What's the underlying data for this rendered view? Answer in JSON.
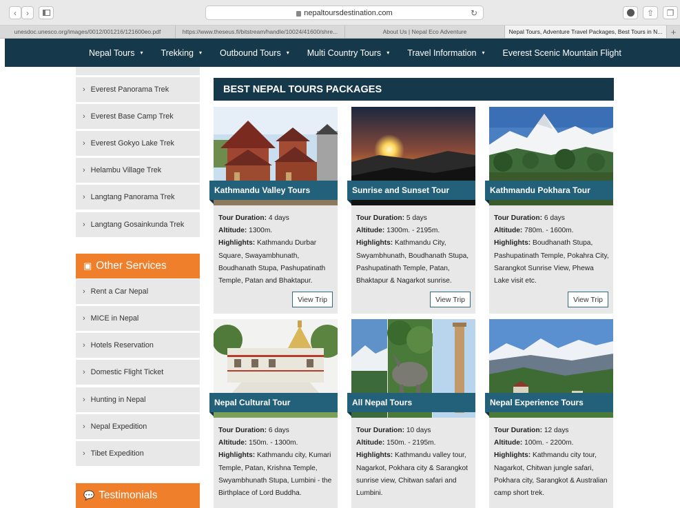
{
  "browser": {
    "url": "nepaltoursdestination.com",
    "tabs": [
      {
        "label": "unesdoc.unesco.org/images/0012/001216/121600eo.pdf",
        "active": false
      },
      {
        "label": "https://www.theseus.fi/bitstream/handle/10024/41600/shre...",
        "active": false
      },
      {
        "label": "About Us | Nepal Eco Adventure",
        "active": false
      },
      {
        "label": "Nepal Tours, Adventure Travel Packages, Best Tours in N...",
        "active": true
      }
    ],
    "new_tab": "+"
  },
  "nav": {
    "items": [
      {
        "label": "Nepal Tours",
        "caret": "▾"
      },
      {
        "label": "Trekking",
        "caret": "▾"
      },
      {
        "label": "Outbound Tours",
        "caret": "▾"
      },
      {
        "label": "Multi Country Tours",
        "caret": "▾"
      },
      {
        "label": "Travel Information",
        "caret": "▾"
      },
      {
        "label": "Everest Scenic Mountain Flight",
        "caret": ""
      }
    ]
  },
  "sidebar": {
    "treks": [
      "Everest Panorama Trek",
      "Everest Base Camp Trek",
      "Everest Gokyo Lake Trek",
      "Helambu Village Trek",
      "Langtang Panorama Trek",
      "Langtang Gosainkunda Trek"
    ],
    "services_title": "Other Services",
    "services": [
      "Rent a Car Nepal",
      "MICE in Nepal",
      "Hotels Reservation",
      "Domestic Flight Ticket",
      "Hunting in Nepal",
      "Nepal Expedition",
      "Tibet Expedition"
    ],
    "testimonials_title": "Testimonials"
  },
  "main": {
    "section_title": "BEST NEPAL TOURS PACKAGES",
    "labels": {
      "duration": "Tour Duration:",
      "altitude": "Altitude:",
      "highlights": "Highlights:"
    },
    "button_label": "View Trip",
    "cards": [
      {
        "title": "Kathmandu Valley Tours",
        "duration": "4 days",
        "altitude": "1300m.",
        "highlights": "Kathmandu Durbar Square, Swayambhunath, Boudhanath Stupa, Pashupatinath Temple, Patan and Bhaktapur."
      },
      {
        "title": "Sunrise and Sunset Tour",
        "duration": "5 days",
        "altitude": "1300m. - 2195m.",
        "highlights": "Kathmandu City, Swyambhunath, Boudhanath Stupa, Pashupatinath Temple, Patan, Bhaktapur & Nagarkot sunrise."
      },
      {
        "title": "Kathmandu Pokhara Tour",
        "duration": "6 days",
        "altitude": "780m. - 1600m.",
        "highlights": "Boudhanath Stupa, Pashupatinath Temple, Pokahra City, Sarangkot Sunrise View, Phewa Lake visit etc."
      },
      {
        "title": "Nepal Cultural Tour",
        "duration": "6 days",
        "altitude": "150m. - 1300m.",
        "highlights": "Kathmandu city, Kumari Temple, Patan, Krishna Temple, Swyambhunath Stupa, Lumbini - the Birthplace of Lord Buddha."
      },
      {
        "title": "All Nepal Tours",
        "duration": "10 days",
        "altitude": "150m. - 2195m.",
        "highlights": "Kathmandu valley tour, Nagarkot, Pokhara city & Sarangkot sunrise view, Chitwan safari and Lumbini."
      },
      {
        "title": "Nepal Experience Tours",
        "duration": "12 days",
        "altitude": "100m. - 2200m.",
        "highlights": "Kathmandu city tour, Nagarkot, Chitwan jungle safari, Pokhara city, Sarangkot & Australian camp short trek."
      }
    ]
  }
}
